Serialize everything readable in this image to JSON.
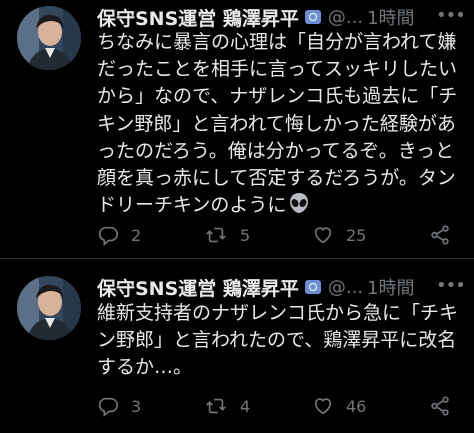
{
  "account": {
    "display_name": "保守SNS運営 鶏澤昇平",
    "handle": "@...",
    "timestamp": "1時間",
    "more_label": "•••"
  },
  "colors": {
    "background": "#000000",
    "text": "#e7e9ea",
    "muted": "#71767b",
    "divider": "#2f3336"
  },
  "tweets": [
    {
      "text": "ちなみに暴言の心理は「自分が言われて嫌\nだったことを相手に言ってスッキリしたい\nから」なので、ナザレンコ氏も過去に「チ\nキン野郎」と言われて悔しかった経験があ\nったのだろう。俺は分かってるぞ。きっと\n顔を真っ赤にして否定するだろうが。タン\nドリーチキンのように",
      "emoji": "alien-icon",
      "reply_count": "2",
      "retweet_count": "5",
      "like_count": "25"
    },
    {
      "text": "維新支持者のナザレンコ氏から急に「チキ\nン野郎」と言われたので、鶏澤昇平に改名\nするか…。",
      "reply_count": "3",
      "retweet_count": "4",
      "like_count": "46"
    }
  ]
}
